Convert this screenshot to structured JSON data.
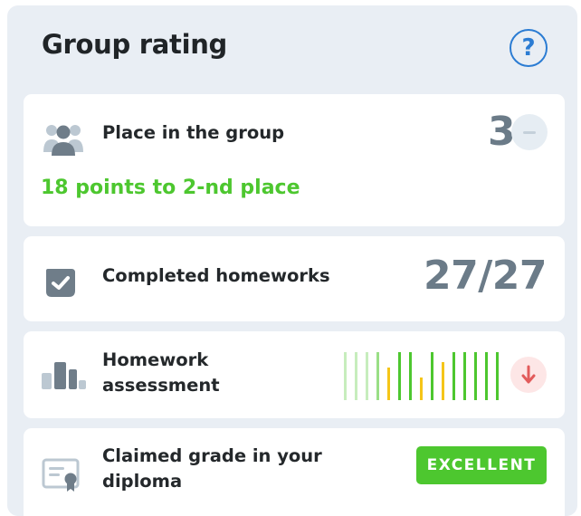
{
  "header": {
    "title": "Group rating",
    "help_symbol": "?"
  },
  "place": {
    "label": "Place in the group",
    "value": "3",
    "trend": "unchanged",
    "note": "18 points to 2-nd place",
    "icon": "group-icon"
  },
  "homeworks": {
    "label": "Completed homeworks",
    "value": "27/27",
    "icon": "checked-shield-icon"
  },
  "assessment": {
    "label_line1": "Homework",
    "label_line2": "assessment",
    "trend": "down",
    "icon": "bar-chart-icon",
    "bars": [
      {
        "level": 0.95,
        "color": "#c7edbd"
      },
      {
        "level": 0.95,
        "color": "#c7edbd"
      },
      {
        "level": 0.95,
        "color": "#c7edbd"
      },
      {
        "level": 0.95,
        "color": "#9adf86"
      },
      {
        "level": 0.65,
        "color": "#f5c518"
      },
      {
        "level": 0.95,
        "color": "#4dc72f"
      },
      {
        "level": 0.95,
        "color": "#4dc72f"
      },
      {
        "level": 0.45,
        "color": "#f5c518"
      },
      {
        "level": 0.95,
        "color": "#4dc72f"
      },
      {
        "level": 0.75,
        "color": "#f5c518"
      },
      {
        "level": 0.95,
        "color": "#4dc72f"
      },
      {
        "level": 0.95,
        "color": "#4dc72f"
      },
      {
        "level": 0.95,
        "color": "#4dc72f"
      },
      {
        "level": 0.95,
        "color": "#4dc72f"
      },
      {
        "level": 0.95,
        "color": "#4dc72f"
      }
    ]
  },
  "diploma": {
    "label_line1": "Claimed grade in your",
    "label_line2": "diploma",
    "grade": "EXCELLENT",
    "icon": "certificate-icon"
  },
  "colors": {
    "accent_blue": "#2b7cd3",
    "positive_green": "#4dc72f",
    "negative_red": "#e25b5b",
    "value_grey": "#6b7b88"
  }
}
